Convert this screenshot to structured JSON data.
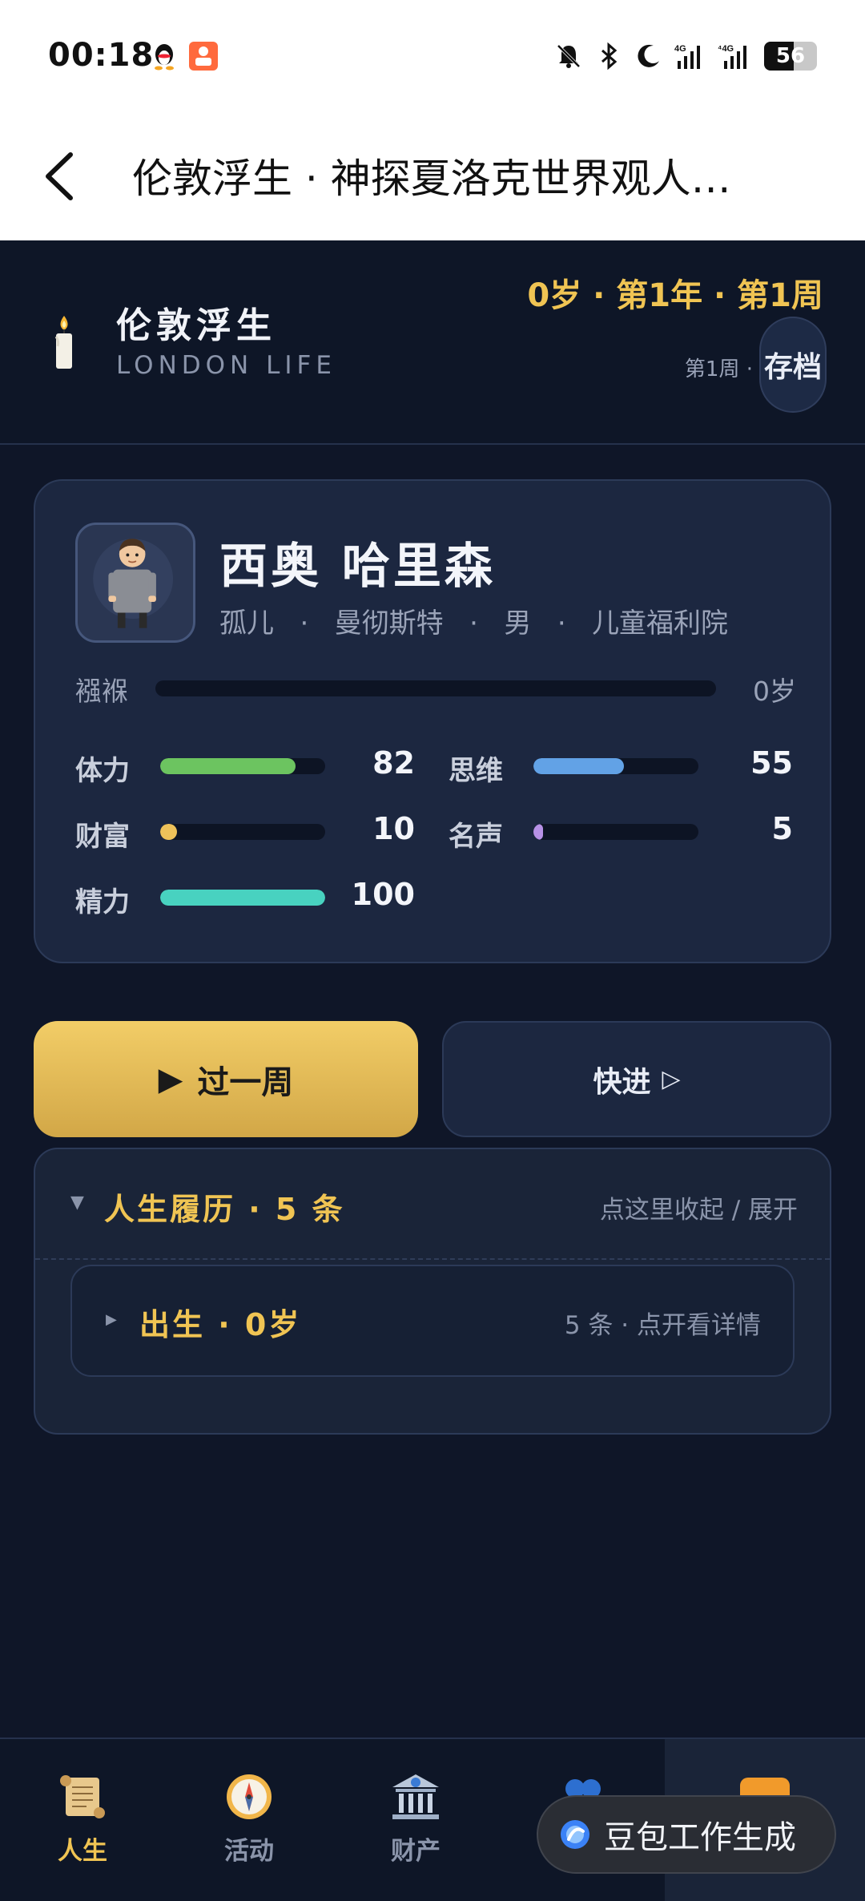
{
  "status_bar": {
    "time": "00:18",
    "app1_icon": "qq-penguin-icon",
    "app2_icon": "orange-app-icon",
    "icons": [
      "mute-bell-icon",
      "bluetooth-icon",
      "moon-icon",
      "signal-4g-icon",
      "signal-4g-2-icon"
    ],
    "battery": "56",
    "battery_level": 0.56
  },
  "nav": {
    "title": "伦敦浮生 · 神探夏洛克世界观人…"
  },
  "header": {
    "brand_title": "伦敦浮生",
    "brand_subtitle": "LONDON LIFE",
    "date_line": "0岁 · 第1年 · 第1周",
    "week_label": "第1周 ·",
    "save_label": "存档"
  },
  "character": {
    "name": "西奥 哈里森",
    "tags": [
      "孤儿",
      "曼彻斯特",
      "男",
      "儿童福利院"
    ],
    "tag_separator": "·",
    "age_stage": "襁褓",
    "age_value": "0岁",
    "age_progress": 0.0,
    "stats": [
      {
        "label": "体力",
        "value": "82",
        "fraction": 0.82,
        "color": "#6cc460"
      },
      {
        "label": "思维",
        "value": "55",
        "fraction": 0.55,
        "color": "#62a2e6"
      },
      {
        "label": "财富",
        "value": "10",
        "fraction": 0.1,
        "color": "#eec25a"
      },
      {
        "label": "名声",
        "value": "5",
        "fraction": 0.05,
        "color": "#b791e6"
      },
      {
        "label": "精力",
        "value": "100",
        "fraction": 1.0,
        "color": "#48d2c0"
      }
    ]
  },
  "actions": {
    "next_week_icon": "▶",
    "next_week_label": "过一周",
    "fast_forward_label": "快进",
    "fast_forward_icon": "▷"
  },
  "history": {
    "toggle_icon": "▼",
    "title": "人生履历 · 5 条",
    "hint": "点这里收起 / 展开",
    "entries": [
      {
        "toggle_icon": "▶",
        "title": "出生 · 0岁",
        "hint": "5 条 · 点开看详情"
      }
    ]
  },
  "bottom_nav": {
    "items": [
      {
        "label": "人生",
        "icon": "scroll-icon",
        "active": true
      },
      {
        "label": "活动",
        "icon": "compass-icon",
        "active": false
      },
      {
        "label": "财产",
        "icon": "bank-icon",
        "active": false
      },
      {
        "label": "",
        "icon": "people-icon",
        "active": false
      },
      {
        "label": "",
        "icon": "fast-forward-icon",
        "active": false
      }
    ]
  },
  "floating": {
    "label": "豆包工作生成",
    "icon": "doubao-logo-icon"
  },
  "colors": {
    "accent_gold": "#f0c453",
    "bg": "#0f1628",
    "card": "#1c2740"
  }
}
